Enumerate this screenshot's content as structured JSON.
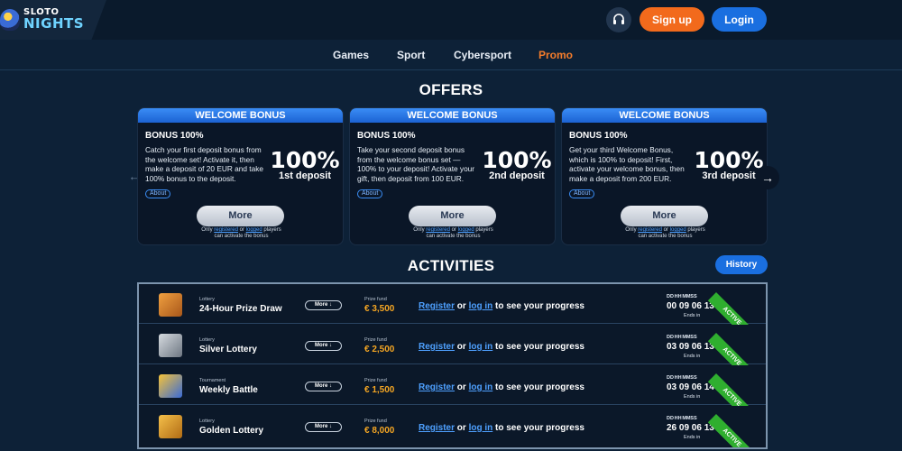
{
  "header": {
    "logo_top": "SLOTO",
    "logo_bottom": "NIGHTS",
    "signup_label": "Sign up",
    "login_label": "Login",
    "support_icon": "headset-icon"
  },
  "nav": {
    "items": [
      {
        "label": "Games"
      },
      {
        "label": "Sport"
      },
      {
        "label": "Cybersport"
      },
      {
        "label": "Promo",
        "active": true
      }
    ]
  },
  "offers": {
    "title": "OFFERS",
    "cards": [
      {
        "header": "WELCOME BONUS",
        "subtitle": "BONUS 100%",
        "description": "Catch your first deposit bonus from the welcome set! Activate it, then make a deposit of 20 EUR and take 100% bonus to the deposit.",
        "big": "100%",
        "big_sub": "1st deposit",
        "about": "About",
        "more": "More",
        "note_only": "Only",
        "note_registered": "registered",
        "note_or": "or",
        "note_logged": "logged",
        "note_players": "players",
        "note_line2": "can activate the bonus"
      },
      {
        "header": "WELCOME BONUS",
        "subtitle": "BONUS 100%",
        "description": "Take your second deposit bonus from the welcome bonus set — 100% to your deposit! Activate your gift, then deposit from 100 EUR.",
        "big": "100%",
        "big_sub": "2nd deposit",
        "about": "About",
        "more": "More",
        "note_only": "Only",
        "note_registered": "registered",
        "note_or": "or",
        "note_logged": "logged",
        "note_players": "players",
        "note_line2": "can activate the bonus"
      },
      {
        "header": "WELCOME BONUS",
        "subtitle": "BONUS 100%",
        "description": "Get your third Welcome Bonus, which is 100% to deposit! First, activate your welcome bonus, then make a deposit from 200 EUR.",
        "big": "100%",
        "big_sub": "3rd deposit",
        "about": "About",
        "more": "More",
        "note_only": "Only",
        "note_registered": "registered",
        "note_or": "or",
        "note_logged": "logged",
        "note_players": "players",
        "note_line2": "can activate the bonus"
      }
    ]
  },
  "activities": {
    "title": "ACTIVITIES",
    "history_label": "History",
    "timer_labels": [
      "DD",
      "HH",
      "MM",
      "SS"
    ],
    "ends_label": "Ends in",
    "rows": [
      {
        "type": "Lottery",
        "name": "24-Hour Prize Draw",
        "more": "More ↓",
        "fund_label": "Prize fund",
        "fund": "€ 3,500",
        "register": "Register",
        "or": " or ",
        "login": "log in",
        "rest": " to see your progress",
        "timer": "00 09 06 13",
        "badge": "ACTIVE",
        "icon": "gold-bars-icon",
        "icon_color": "#d9822b"
      },
      {
        "type": "Lottery",
        "name": "Silver Lottery",
        "more": "More ↓",
        "fund_label": "Prize fund",
        "fund": "€ 2,500",
        "register": "Register",
        "or": " or ",
        "login": "log in",
        "rest": " to see your progress",
        "timer": "03 09 06 13",
        "badge": "ACTIVE",
        "icon": "silver-bars-icon",
        "icon_color": "#9aa3ad"
      },
      {
        "type": "Tournament",
        "name": "Weekly Battle",
        "more": "More ↓",
        "fund_label": "Prize fund",
        "fund": "€ 1,500",
        "register": "Register",
        "or": " or ",
        "login": "log in",
        "rest": " to see your progress",
        "timer": "03 09 06 14",
        "badge": "ACTIVE",
        "icon": "dice-icon",
        "icon_color": "#3a6bd6"
      },
      {
        "type": "Lottery",
        "name": "Golden Lottery",
        "more": "More ↓",
        "fund_label": "Prize fund",
        "fund": "€ 8,000",
        "register": "Register",
        "or": " or ",
        "login": "log in",
        "rest": " to see your progress",
        "timer": "26 09 06 13",
        "badge": "ACTIVE",
        "icon": "gold-bars-icon",
        "icon_color": "#e0a22a"
      }
    ]
  }
}
